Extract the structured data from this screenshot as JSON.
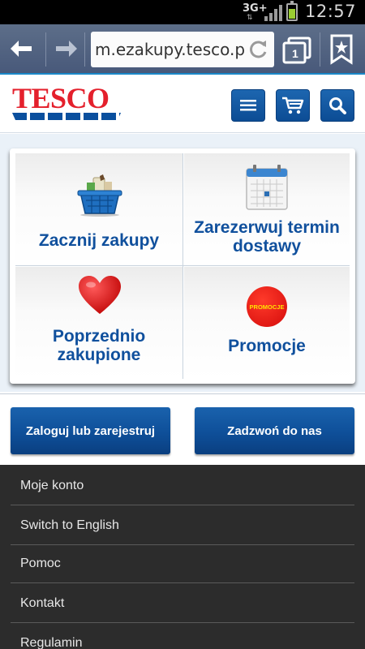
{
  "status_bar": {
    "network": "3G+",
    "time": "12:57",
    "battery_color": "#9acd32"
  },
  "browser": {
    "url": "m.ezakupy.tesco.pl/m",
    "tab_count": "1",
    "icons": [
      "back-arrow-icon",
      "forward-arrow-icon",
      "reload-icon",
      "tabs-icon",
      "bookmark-icon"
    ]
  },
  "header": {
    "logo_text": "TESCO",
    "buttons": [
      "menu-icon",
      "cart-icon",
      "search-icon"
    ],
    "accent": "#0e4f99",
    "logo_color": "#e4202c"
  },
  "tiles": [
    {
      "label_line1": "Zacznij zakupy",
      "label_line2": "",
      "icon": "shopping-basket-icon"
    },
    {
      "label_line1": "Zarezerwuj termin",
      "label_line2": "dostawy",
      "icon": "calendar-icon"
    },
    {
      "label_line1": "Poprzednio",
      "label_line2": "zakupione",
      "icon": "heart-icon"
    },
    {
      "label_line1": "Promocje",
      "label_line2": "",
      "icon": "promocje-badge-icon",
      "badge_text": "PROMOCJE"
    }
  ],
  "actions": {
    "login": "Zaloguj lub zarejestruj",
    "call": "Zadzwoń do nas"
  },
  "menu": {
    "items": [
      "Moje konto",
      "Switch to English",
      "Pomoc",
      "Kontakt",
      "Regulamin"
    ]
  }
}
